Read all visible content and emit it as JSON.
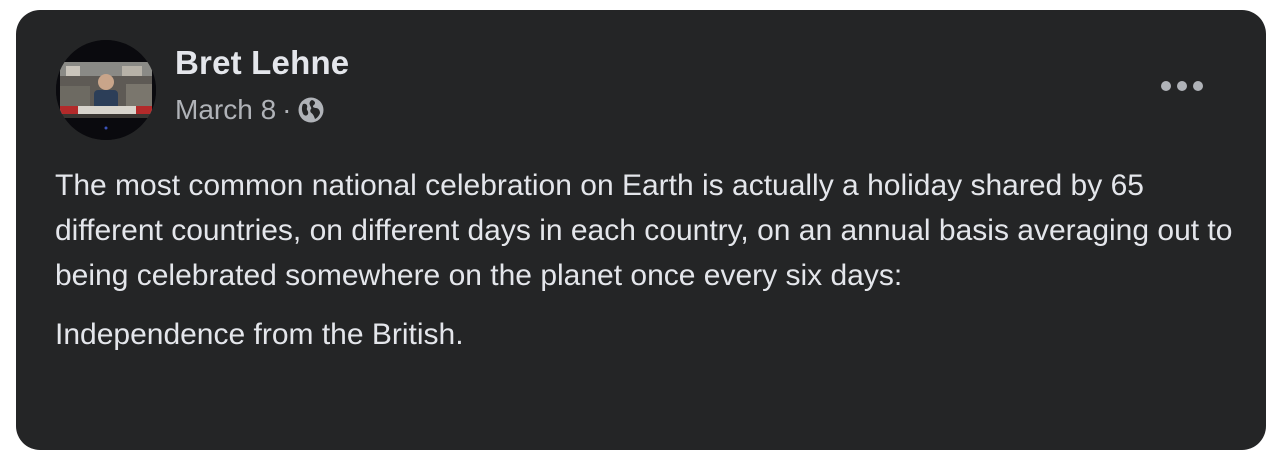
{
  "post": {
    "author": "Bret Lehne",
    "date": "March 8",
    "separator": "·",
    "audience_icon": "globe-icon",
    "more_icon": "more-options-icon",
    "paragraphs": [
      "The most common national celebration on Earth is actually a holiday shared by 65 different countries, on different days in each country, on an annual basis averaging out to being celebrated somewhere on the planet once every six days:",
      "Independence from the British."
    ]
  },
  "colors": {
    "card_background": "#242526",
    "primary_text": "#e4e6eb",
    "secondary_text": "#b0b3b8"
  }
}
